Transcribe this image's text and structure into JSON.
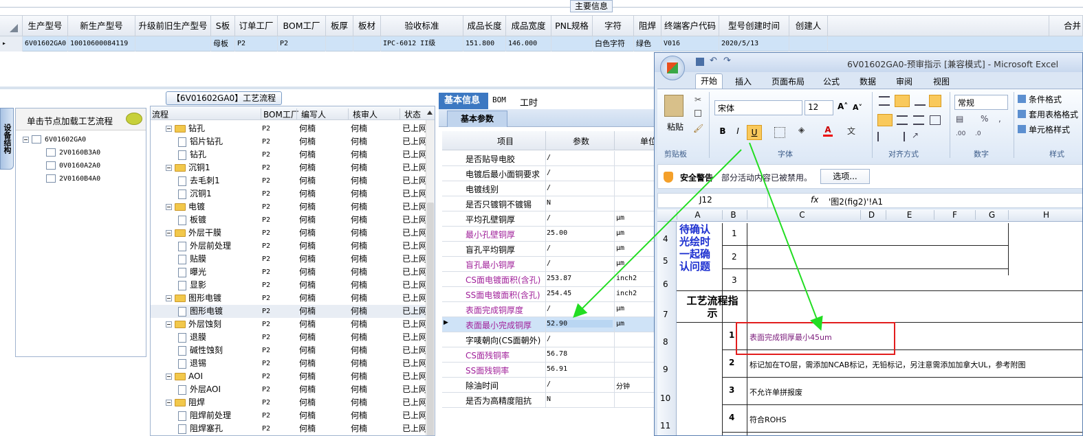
{
  "top": {
    "main_info_label": "主要信息",
    "columns": [
      "生产型号",
      "新生产型号",
      "升级前旧生产型号",
      "S板",
      "订单工厂",
      "BOM工厂",
      "板厚",
      "板材",
      "验收标准",
      "成品长度",
      "成品宽度",
      "PNL规格",
      "字符",
      "阻焊",
      "终端客户代码",
      "型号创建时间",
      "创建人"
    ],
    "right_header_partial": "合并",
    "row": [
      "6V01602GA0",
      "10010600084119",
      "",
      "母板",
      "P2",
      "P2",
      "",
      "",
      "IPC-6012 II级",
      "151.800",
      "146.000",
      "",
      "白色字符",
      "绿色",
      "V016",
      "2020/5/13",
      ""
    ]
  },
  "left_panel": {
    "side_tab": "设备结构",
    "hint": "单击节点加载工艺流程",
    "root": "6V01602GA0",
    "children": [
      "2V0160B3A0",
      "0V0160A2A0",
      "2V0160B4A0"
    ]
  },
  "process_panel": {
    "title": "【6V01602GA0】工艺流程",
    "columns": [
      "流程",
      "BOM工厂",
      "编写人",
      "核审人",
      "状态"
    ],
    "rows": [
      {
        "name": "钻孔",
        "type": "folder",
        "bom": "P2",
        "writer": "何楠",
        "reviewer": "何楠",
        "status": "已上网"
      },
      {
        "name": "铝片钻孔",
        "type": "doc",
        "bom": "P2",
        "writer": "何楠",
        "reviewer": "何楠",
        "status": "已上网"
      },
      {
        "name": "钻孔",
        "type": "doc",
        "bom": "P2",
        "writer": "何楠",
        "reviewer": "何楠",
        "status": "已上网"
      },
      {
        "name": "沉铜1",
        "type": "folder",
        "bom": "P2",
        "writer": "何楠",
        "reviewer": "何楠",
        "status": "已上网"
      },
      {
        "name": "去毛刺1",
        "type": "doc",
        "bom": "P2",
        "writer": "何楠",
        "reviewer": "何楠",
        "status": "已上网"
      },
      {
        "name": "沉铜1",
        "type": "doc",
        "bom": "P2",
        "writer": "何楠",
        "reviewer": "何楠",
        "status": "已上网"
      },
      {
        "name": "电镀",
        "type": "folder",
        "bom": "P2",
        "writer": "何楠",
        "reviewer": "何楠",
        "status": "已上网"
      },
      {
        "name": "板镀",
        "type": "doc",
        "bom": "P2",
        "writer": "何楠",
        "reviewer": "何楠",
        "status": "已上网"
      },
      {
        "name": "外层干膜",
        "type": "folder",
        "bom": "P2",
        "writer": "何楠",
        "reviewer": "何楠",
        "status": "已上网"
      },
      {
        "name": "外层前处理",
        "type": "doc",
        "bom": "P2",
        "writer": "何楠",
        "reviewer": "何楠",
        "status": "已上网"
      },
      {
        "name": "贴膜",
        "type": "doc",
        "bom": "P2",
        "writer": "何楠",
        "reviewer": "何楠",
        "status": "已上网"
      },
      {
        "name": "曝光",
        "type": "doc",
        "bom": "P2",
        "writer": "何楠",
        "reviewer": "何楠",
        "status": "已上网"
      },
      {
        "name": "显影",
        "type": "doc",
        "bom": "P2",
        "writer": "何楠",
        "reviewer": "何楠",
        "status": "已上网"
      },
      {
        "name": "图形电镀",
        "type": "folder",
        "bom": "P2",
        "writer": "何楠",
        "reviewer": "何楠",
        "status": "已上网"
      },
      {
        "name": "图形电镀",
        "type": "doc",
        "bom": "P2",
        "writer": "何楠",
        "reviewer": "何楠",
        "status": "已上网"
      },
      {
        "name": "外层蚀刻",
        "type": "folder",
        "bom": "P2",
        "writer": "何楠",
        "reviewer": "何楠",
        "status": "已上网"
      },
      {
        "name": "退膜",
        "type": "doc",
        "bom": "P2",
        "writer": "何楠",
        "reviewer": "何楠",
        "status": "已上网"
      },
      {
        "name": "碱性蚀刻",
        "type": "doc",
        "bom": "P2",
        "writer": "何楠",
        "reviewer": "何楠",
        "status": "已上网"
      },
      {
        "name": "退锡",
        "type": "doc",
        "bom": "P2",
        "writer": "何楠",
        "reviewer": "何楠",
        "status": "已上网"
      },
      {
        "name": "AOI",
        "type": "folder",
        "bom": "P2",
        "writer": "何楠",
        "reviewer": "何楠",
        "status": "已上网"
      },
      {
        "name": "外层AOI",
        "type": "doc",
        "bom": "P2",
        "writer": "何楠",
        "reviewer": "何楠",
        "status": "已上网"
      },
      {
        "name": "阻焊",
        "type": "folder",
        "bom": "P2",
        "writer": "何楠",
        "reviewer": "何楠",
        "status": "已上网"
      },
      {
        "name": "阻焊前处理",
        "type": "doc",
        "bom": "P2",
        "writer": "何楠",
        "reviewer": "何楠",
        "status": "已上网"
      },
      {
        "name": "阻焊塞孔",
        "type": "doc",
        "bom": "P2",
        "writer": "何楠",
        "reviewer": "何楠",
        "status": "已上网"
      }
    ]
  },
  "params_panel": {
    "tabs": [
      "基本信息",
      "BOM",
      "工时"
    ],
    "subtab": "基本参数",
    "columns": [
      "项目",
      "参数",
      "单位"
    ],
    "rows": [
      {
        "item": "是否贴导电胶",
        "value": "/",
        "unit": "",
        "pink": false
      },
      {
        "item": "电镀后最小面铜要求",
        "value": "/",
        "unit": "",
        "pink": false
      },
      {
        "item": "电镀线别",
        "value": "/",
        "unit": "",
        "pink": false
      },
      {
        "item": "是否只镀铜不镀锡",
        "value": "N",
        "unit": "",
        "pink": false
      },
      {
        "item": "平均孔壁铜厚",
        "value": "/",
        "unit": "μm",
        "pink": false
      },
      {
        "item": "最小孔壁铜厚",
        "value": "25.00",
        "unit": "μm",
        "pink": true
      },
      {
        "item": "盲孔平均铜厚",
        "value": "/",
        "unit": "μm",
        "pink": false
      },
      {
        "item": "盲孔最小铜厚",
        "value": "/",
        "unit": "μm",
        "pink": true
      },
      {
        "item": "CS面电镀面积(含孔)",
        "value": "253.87",
        "unit": "inch2",
        "pink": true
      },
      {
        "item": "SS面电镀面积(含孔)",
        "value": "254.45",
        "unit": "inch2",
        "pink": true
      },
      {
        "item": "表面完成铜厚度",
        "value": "/",
        "unit": "μm",
        "pink": true
      },
      {
        "item": "表面最小完成铜厚",
        "value": "52.90",
        "unit": "μm",
        "pink": true
      },
      {
        "item": "字唛朝向(CS面朝外)",
        "value": "/",
        "unit": "",
        "pink": false
      },
      {
        "item": "CS面残铜率",
        "value": "56.78",
        "unit": "",
        "pink": true
      },
      {
        "item": "SS面残铜率",
        "value": "56.91",
        "unit": "",
        "pink": true
      },
      {
        "item": "除油时间",
        "value": "/",
        "unit": "分钟",
        "pink": false
      },
      {
        "item": "是否为高精度阻抗",
        "value": "N",
        "unit": "",
        "pink": false
      }
    ]
  },
  "excel": {
    "title": "6V01602GA0-预审指示 [兼容模式] - Microsoft Excel",
    "ribbon_tabs": [
      "开始",
      "插入",
      "页面布局",
      "公式",
      "数据",
      "审阅",
      "视图"
    ],
    "paste_label": "粘贴",
    "clipboard_label": "剪贴板",
    "font_name": "宋体",
    "font_size": "12",
    "font_group_label": "字体",
    "align_group_label": "对齐方式",
    "number_format": "常规",
    "number_group_label": "数字",
    "styles": [
      "条件格式",
      "套用表格格式",
      "单元格样式"
    ],
    "styles_group_label": "样式",
    "security_title": "安全警告",
    "security_msg": "部分活动内容已被禁用。",
    "options_btn": "选项...",
    "name_box": "J12",
    "formula": "'图2(fig2)'!A1",
    "col_headers": [
      "A",
      "B",
      "C",
      "D",
      "E",
      "F",
      "G",
      "H"
    ],
    "row_numbers": [
      "4",
      "5",
      "6",
      "7",
      "8",
      "9",
      "10",
      "11"
    ],
    "blue_note": "待确认光绘时一起确认问题",
    "blue_nums": [
      "1",
      "2",
      "3"
    ],
    "section_title": "工艺流程指示",
    "items": [
      {
        "num": "1",
        "text": "表面完成铜厚最小45um"
      },
      {
        "num": "2",
        "text": "标记加在TO层，需添加NCAB标记，无铅标记，另注意需添加加拿大UL，参考附图"
      },
      {
        "num": "3",
        "text": "不允许单拼报废"
      },
      {
        "num": "4",
        "text": "符合ROHS"
      }
    ]
  }
}
